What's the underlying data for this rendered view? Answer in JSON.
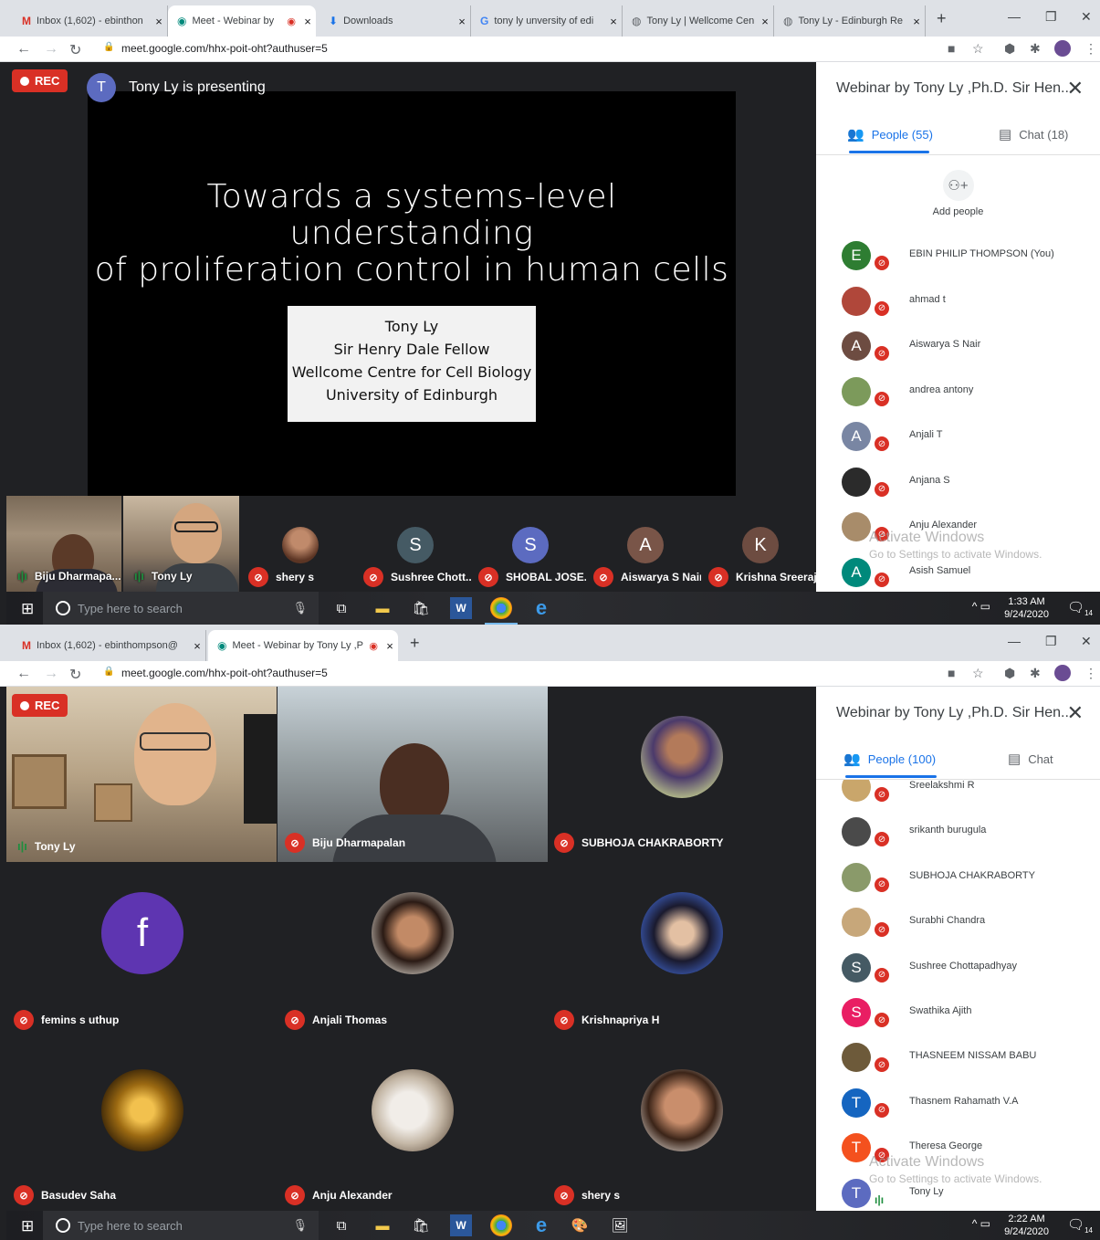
{
  "s1": {
    "tabs": [
      {
        "icon": "gmail-icon",
        "glyph": "M",
        "title": "Inbox (1,602) - ebinthon",
        "close": "×"
      },
      {
        "icon": "meet-icon",
        "glyph": "◉",
        "title": "Meet - Webinar by",
        "close": "×",
        "recording": "◉"
      },
      {
        "icon": "download-icon",
        "glyph": "⬇",
        "title": "Downloads",
        "close": "×"
      },
      {
        "icon": "google-icon",
        "glyph": "G",
        "title": "tony ly unversity of edi",
        "close": "×"
      },
      {
        "icon": "globe-icon",
        "glyph": "🌐",
        "title": "Tony Ly | Wellcome Cen",
        "close": "×"
      },
      {
        "icon": "globe-icon",
        "glyph": "🌐",
        "title": "Tony Ly - Edinburgh Re",
        "close": "×"
      }
    ],
    "url": "meet.google.com/hhx-poit-oht?authuser=5",
    "rec_label": "REC",
    "presenter_initial": "T",
    "presenting_text": "Tony Ly is presenting",
    "slide": {
      "title_line1": "Towards a systems-level understanding",
      "title_line2": "of proliferation control in human cells",
      "box_line1": "Tony Ly",
      "box_line2": "Sir Henry Dale Fellow",
      "box_line3": "Wellcome Centre for Cell Biology",
      "box_line4": "University of Edinburgh"
    },
    "strip": {
      "video1_name": "Biju Dharmapa...",
      "video2_name": "Tony Ly",
      "tiles": [
        {
          "initial": "",
          "name": "shery s",
          "color": "#8d5a3b"
        },
        {
          "initial": "S",
          "name": "Sushree Chott...",
          "color": "#455a64"
        },
        {
          "initial": "S",
          "name": "SHOBAL JOSE...",
          "color": "#5c6bc0"
        },
        {
          "initial": "A",
          "name": "Aiswarya S Nair",
          "color": "#795548"
        },
        {
          "initial": "K",
          "name": "Krishna Sreeraj",
          "color": "#6d4c41"
        }
      ]
    },
    "panel": {
      "title": "Webinar by Tony Ly ,Ph.D. Sir Hen...",
      "people_tab": "People (55)",
      "chat_tab": "Chat (18)",
      "add_people": "Add people",
      "people": [
        {
          "initial": "E",
          "name": "EBIN PHILIP THOMPSON (You)",
          "color": "#2e7d32"
        },
        {
          "initial": "",
          "name": "ahmad t",
          "color": "#b0473a"
        },
        {
          "initial": "A",
          "name": "Aiswarya S Nair",
          "color": "#6d4c41"
        },
        {
          "initial": "",
          "name": "andrea antony",
          "color": "#7c9a5b"
        },
        {
          "initial": "A",
          "name": "Anjali T",
          "color": "#7986a3"
        },
        {
          "initial": "",
          "name": "Anjana S",
          "color": "#2b2b2b"
        },
        {
          "initial": "",
          "name": "Anju Alexander",
          "color": "#a88c6a"
        },
        {
          "initial": "A",
          "name": "Asish Samuel",
          "color": "#00897b"
        }
      ],
      "activate_line1": "Activate Windows",
      "activate_line2": "Go to Settings to activate Windows."
    },
    "taskbar": {
      "search_placeholder": "Type here to search",
      "time": "1:33 AM",
      "date": "9/24/2020",
      "notifications": "14"
    }
  },
  "s2": {
    "tabs": [
      {
        "icon": "gmail-icon",
        "glyph": "M",
        "title": "Inbox (1,602) - ebinthompson@",
        "close": "×"
      },
      {
        "icon": "meet-icon",
        "glyph": "◉",
        "title": "Meet - Webinar by Tony Ly ,P",
        "close": "×",
        "recording": "◉"
      }
    ],
    "url": "meet.google.com/hhx-poit-oht?authuser=5",
    "rec_label": "REC",
    "grid": [
      {
        "name": "Tony Ly",
        "kind": "video",
        "speaking": true
      },
      {
        "name": "Biju Dharmapalan",
        "kind": "video"
      },
      {
        "name": "SUBHOJA CHAKRABORTY",
        "kind": "photo",
        "color": "#6b7b5a"
      },
      {
        "name": "femins s uthup",
        "kind": "letter",
        "initial": "f",
        "color": "#5e35b1"
      },
      {
        "name": "Anjali Thomas",
        "kind": "photo",
        "color": "#3e2a20"
      },
      {
        "name": "Krishnapriya H",
        "kind": "photo",
        "color": "#1f2a4a"
      },
      {
        "name": "Basudev Saha",
        "kind": "photo",
        "color": "#8a5a10"
      },
      {
        "name": "Anju Alexander",
        "kind": "photo",
        "color": "#cfc6bb"
      },
      {
        "name": "shery s",
        "kind": "photo",
        "color": "#8d5a3b"
      }
    ],
    "panel": {
      "title": "Webinar by Tony Ly ,Ph.D. Sir Hen...",
      "people_tab": "People (100)",
      "chat_tab": "Chat",
      "people": [
        {
          "initial": "",
          "name": "Sreelakshmi R",
          "color": "#c9a66b"
        },
        {
          "initial": "",
          "name": "srikanth burugula",
          "color": "#4a4a4a"
        },
        {
          "initial": "",
          "name": "SUBHOJA CHAKRABORTY",
          "color": "#8a9a6a"
        },
        {
          "initial": "",
          "name": "Surabhi Chandra",
          "color": "#c7a77a"
        },
        {
          "initial": "S",
          "name": "Sushree Chottapadhyay",
          "color": "#455a64"
        },
        {
          "initial": "S",
          "name": "Swathika Ajith",
          "color": "#e91e63"
        },
        {
          "initial": "",
          "name": "THASNEEM NISSAM BABU",
          "color": "#6d5a3a"
        },
        {
          "initial": "T",
          "name": "Thasnem Rahamath V.A",
          "color": "#1565c0"
        },
        {
          "initial": "T",
          "name": "Theresa George",
          "color": "#f4511e"
        },
        {
          "initial": "T",
          "name": "Tony Ly",
          "color": "#5c6bc0",
          "speaking": true
        }
      ],
      "activate_line1": "Activate Windows",
      "activate_line2": "Go to Settings to activate Windows."
    },
    "taskbar": {
      "search_placeholder": "Type here to search",
      "time": "2:22 AM",
      "date": "9/24/2020",
      "notifications": "14"
    }
  },
  "colors": {
    "rec": "#d93025",
    "accent": "#1a73e8",
    "speaking": "#1e8e3e",
    "bg": "#202124"
  }
}
